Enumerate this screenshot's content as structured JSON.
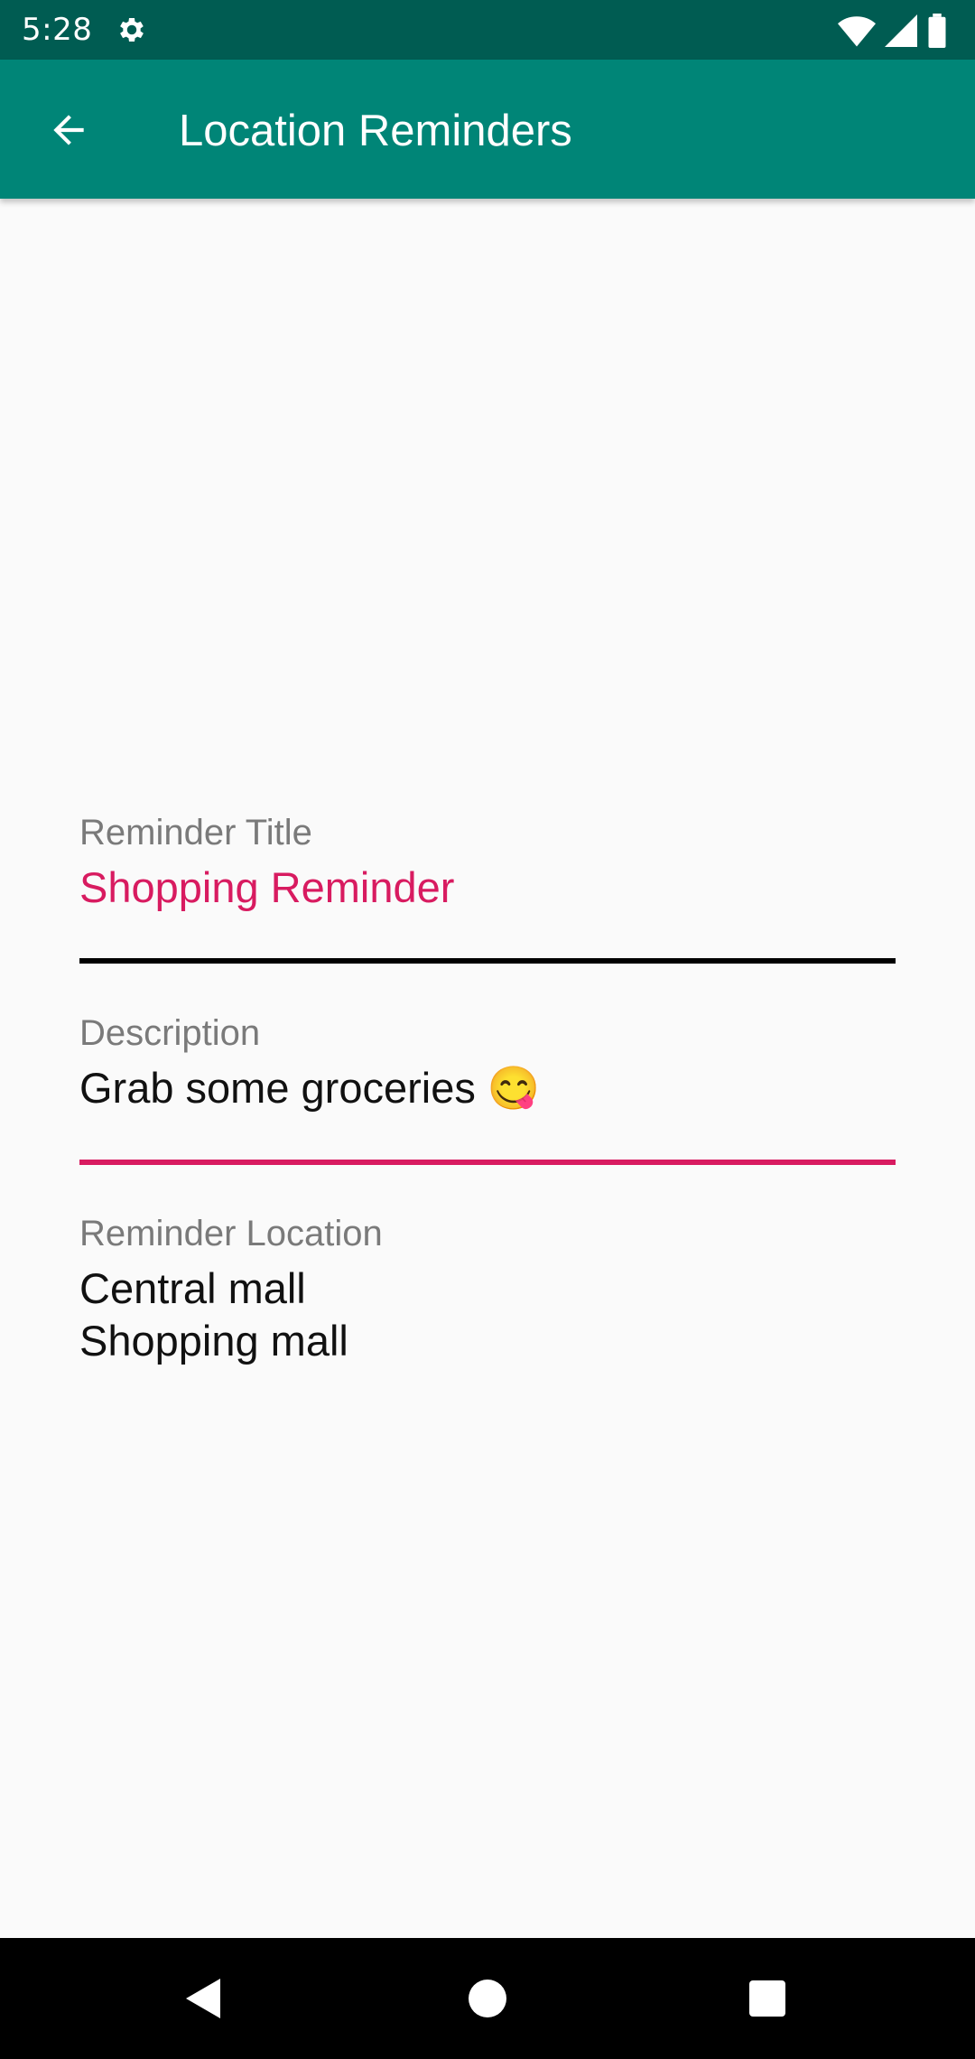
{
  "status_bar": {
    "time": "5:28",
    "icons": [
      "settings-icon",
      "wifi-icon",
      "signal-icon",
      "battery-icon"
    ]
  },
  "app_bar": {
    "back_icon": "arrow-back-icon",
    "title": "Location Reminders",
    "background_color": "#008577"
  },
  "fields": {
    "title": {
      "label": "Reminder Title",
      "value": "Shopping Reminder",
      "color": "#d81b60"
    },
    "description": {
      "label": "Description",
      "value": "Grab some groceries 😋"
    },
    "location": {
      "label": "Reminder Location",
      "value": "Central mall\nShopping mall"
    }
  },
  "nav_bar": {
    "icons": [
      "back-triangle-icon",
      "home-circle-icon",
      "recents-square-icon"
    ]
  }
}
